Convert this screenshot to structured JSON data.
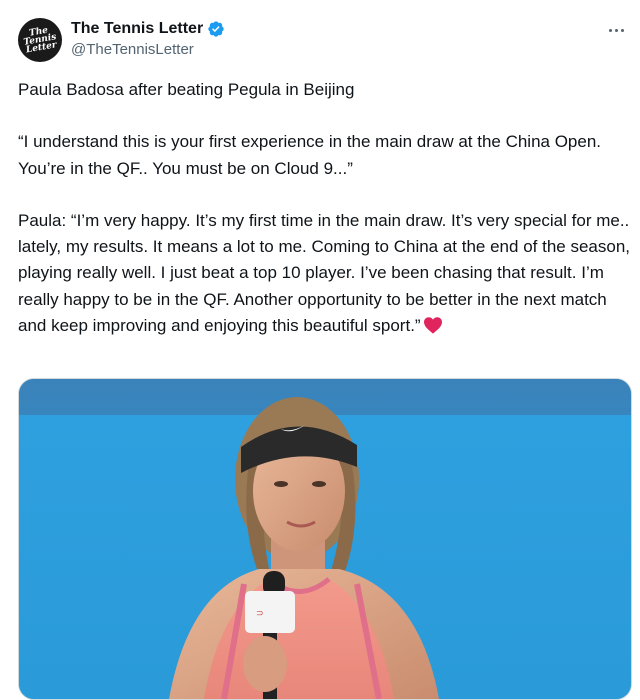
{
  "account": {
    "display_name": "The Tennis Letter",
    "handle": "@TheTennisLetter",
    "avatar_logo_text": "The Tennis Letter",
    "verified_color": "#1d9bf0"
  },
  "more_icon": "more-horizontal-icon",
  "tweet": {
    "paragraphs": [
      "Paula Badosa after beating Pegula in Beijing",
      "“I understand this is your first experience in the main draw at the China Open. You’re in the QF.. You must be on Cloud 9...”",
      "Paula: “I’m very happy. It’s my first time in the main draw. It’s very special for me.. lately, my results. It means a lot to me. Coming to China at the end of the season, playing really well. I just beat a top 10 player. I’ve been chasing that result. I’m really happy to be in the QF. Another opportunity to be better in the next match and keep improving and enjoying this beautiful sport.”"
    ],
    "emoji": "heart-icon",
    "emoji_color": "#e0245e"
  },
  "media": {
    "type": "photo",
    "description_icon": "player-interview-photo"
  }
}
